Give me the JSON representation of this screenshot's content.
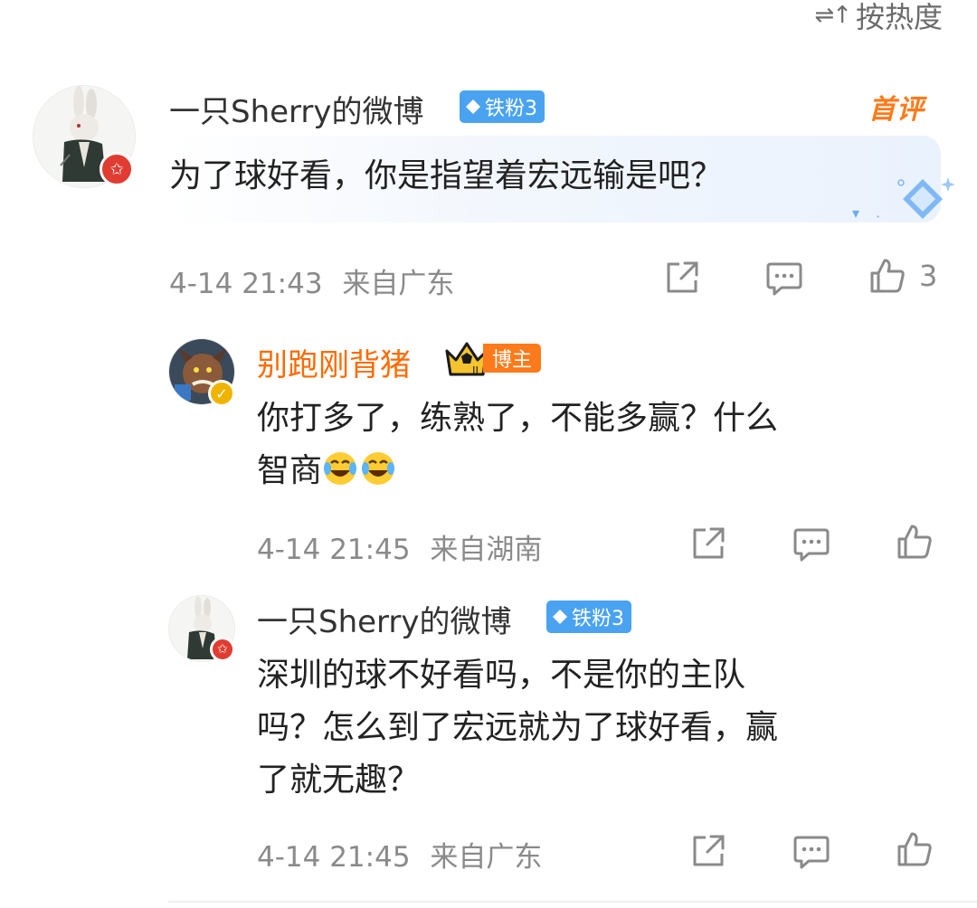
{
  "sort": {
    "label": "按热度",
    "icon": "sort-icon"
  },
  "comments": [
    {
      "user": "一只Sherry的微博",
      "fan_tag": "铁粉3",
      "first_badge": "首评",
      "text": "为了球好看，你是指望着宏远输是吧？",
      "time": "4-14 21:43",
      "location": "来自广东",
      "likes": "3"
    },
    {
      "user": "别跑刚背猪",
      "host_tag": "博主",
      "text_line1": "你打多了，练熟了，不能多赢？什么",
      "text_line2": "智商",
      "time": "4-14 21:45",
      "location": "来自湖南"
    },
    {
      "user": "一只Sherry的微博",
      "fan_tag": "铁粉3",
      "text_line1": "深圳的球不好看吗，不是你的主队",
      "text_line2": "吗？怎么到了宏远就为了球好看，赢",
      "text_line3": "了就无趣？",
      "time": "4-14 21:45",
      "location": "来自广东"
    }
  ],
  "icons": {
    "share": "share-icon",
    "comment": "comment-icon",
    "like": "like-icon",
    "emoji": "laugh-cry-emoji"
  },
  "colors": {
    "blogger_name": "#ff6a00",
    "fan_tag": "#4aa3f0",
    "host_tag": "#ff7a1a",
    "meta": "#8a8a8a"
  }
}
